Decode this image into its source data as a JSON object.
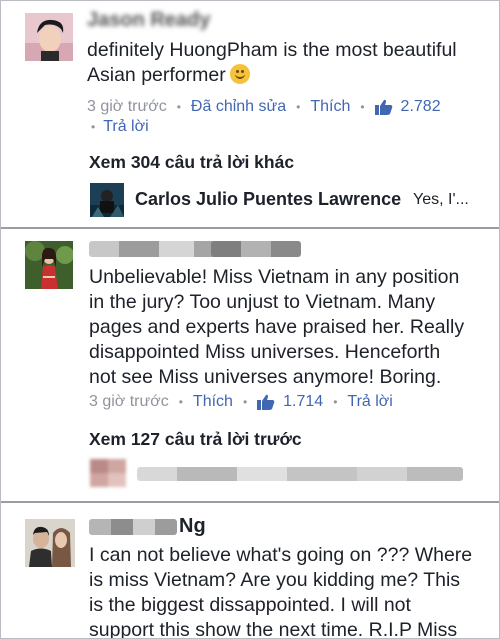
{
  "comments": [
    {
      "author": "Jason Ready",
      "lines": [
        "definitely HuongPham is the most beautiful",
        "Asian performer"
      ],
      "emoji": "smiling-face-icon",
      "time": "3 giờ trước",
      "edited": "Đã chỉnh sửa",
      "like": "Thích",
      "like_count": "2.782",
      "reply": "Trả lời",
      "view_more": "Xem 304 câu trả lời khác",
      "top_reply": {
        "author": "Carlos Julio Puentes Lawrence",
        "snippet": "Yes, I'..."
      }
    },
    {
      "lines": [
        "Unbelievable! Miss Vietnam in any position",
        "in the jury? Too unjust to Vietnam. Many",
        "pages and experts have praised her. Really",
        "disappointed Miss universes. Henceforth",
        "not see Miss universes anymore! Boring."
      ],
      "time": "3 giờ trước",
      "like": "Thích",
      "like_count": "1.714",
      "reply": "Trả lời",
      "view_prev": "Xem 127 câu trả lời trước"
    },
    {
      "author_suffix": "Ng",
      "lines": [
        "I can not believe what's going on ??? Where",
        "is miss Vietnam? Are you kidding me? This",
        "is the biggest dissappointed. I will not",
        "support this show the next time. R.I.P Miss"
      ]
    }
  ],
  "colors": {
    "link": "#4267b2",
    "meta": "#90949c",
    "text": "#1d2129"
  }
}
